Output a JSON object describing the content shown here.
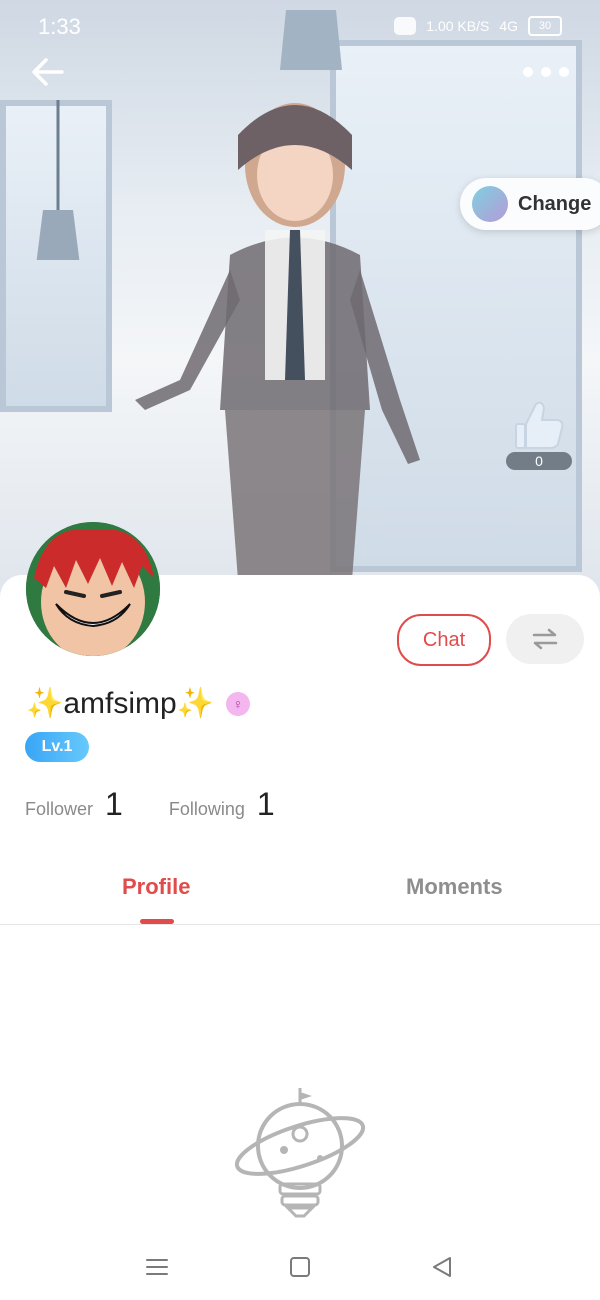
{
  "status_bar": {
    "time": "1:33",
    "net_speed": "1.00 KB/S",
    "network": "4G",
    "battery": "30"
  },
  "header": {
    "change_label": "Change"
  },
  "like": {
    "count": "0"
  },
  "profile": {
    "username": "✨amfsimp✨",
    "level": "Lv.1",
    "chat_label": "Chat",
    "follower_label": "Follower",
    "follower_count": "1",
    "following_label": "Following",
    "following_count": "1"
  },
  "tabs": [
    {
      "label": "Profile"
    },
    {
      "label": "Moments"
    }
  ],
  "icons": {
    "back": "arrow-left-icon",
    "more": "more-dots-icon",
    "like": "thumbs-up-icon",
    "swap": "swap-arrows-icon",
    "gender": "female-symbol-icon",
    "empty_state": "planet-bulb-illustration",
    "nav_menu": "menu-icon",
    "nav_home": "square-icon",
    "nav_back": "triangle-back-icon"
  },
  "colors": {
    "accent": "#e04b4b",
    "level_badge": "#39a5f6",
    "gender_badge": "#f3b6ee"
  }
}
